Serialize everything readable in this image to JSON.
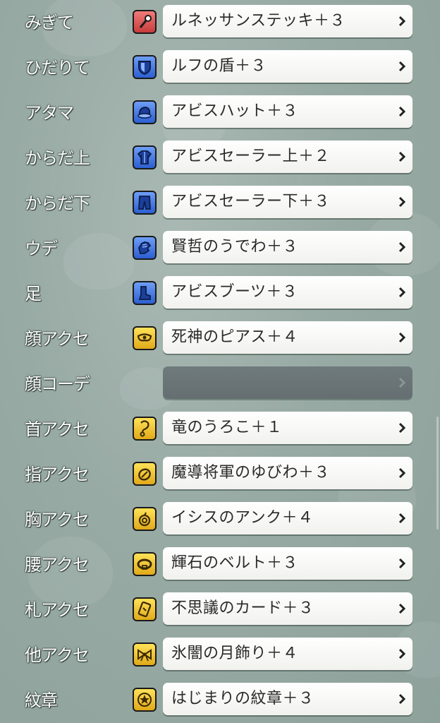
{
  "colors": {
    "red_icon": "#d94d4d",
    "blue_icon": "#2f63d6",
    "gold_icon": "#f0bf23",
    "button_bg": "#ffffff",
    "empty_button_bg": "#6b7577",
    "label_text": "#ffffff"
  },
  "equipment": [
    {
      "slot": "みぎて",
      "item": "ルネッサンステッキ＋３",
      "icon": "wand-icon",
      "icon_color": "red"
    },
    {
      "slot": "ひだりて",
      "item": "ルフの盾＋３",
      "icon": "shield-icon",
      "icon_color": "blue"
    },
    {
      "slot": "アタマ",
      "item": "アビスハット＋３",
      "icon": "hat-icon",
      "icon_color": "blue"
    },
    {
      "slot": "からだ上",
      "item": "アビスセーラー上＋２",
      "icon": "body-armor-icon",
      "icon_color": "blue"
    },
    {
      "slot": "からだ下",
      "item": "アビスセーラー下＋３",
      "icon": "pants-icon",
      "icon_color": "blue"
    },
    {
      "slot": "ウデ",
      "item": "賢哲のうでわ＋３",
      "icon": "glove-icon",
      "icon_color": "blue"
    },
    {
      "slot": "足",
      "item": "アビスブーツ＋３",
      "icon": "boots-icon",
      "icon_color": "blue"
    },
    {
      "slot": "顔アクセ",
      "item": "死神のピアス＋４",
      "icon": "mask-icon",
      "icon_color": "gold"
    },
    {
      "slot": "顔コーデ",
      "item": "",
      "icon": "",
      "icon_color": ""
    },
    {
      "slot": "首アクセ",
      "item": "竜のうろこ＋１",
      "icon": "necklace-icon",
      "icon_color": "gold"
    },
    {
      "slot": "指アクセ",
      "item": "魔導将軍のゆびわ＋３",
      "icon": "ring-icon",
      "icon_color": "gold"
    },
    {
      "slot": "胸アクセ",
      "item": "イシスのアンク＋４",
      "icon": "brooch-icon",
      "icon_color": "gold"
    },
    {
      "slot": "腰アクセ",
      "item": "輝石のベルト＋３",
      "icon": "belt-icon",
      "icon_color": "gold"
    },
    {
      "slot": "札アクセ",
      "item": "不思議のカード＋３",
      "icon": "card-icon",
      "icon_color": "gold"
    },
    {
      "slot": "他アクセ",
      "item": "氷闇の月飾り＋４",
      "icon": "bow-icon",
      "icon_color": "gold"
    },
    {
      "slot": "紋章",
      "item": "はじまりの紋章＋３",
      "icon": "emblem-icon",
      "icon_color": "gold"
    }
  ]
}
